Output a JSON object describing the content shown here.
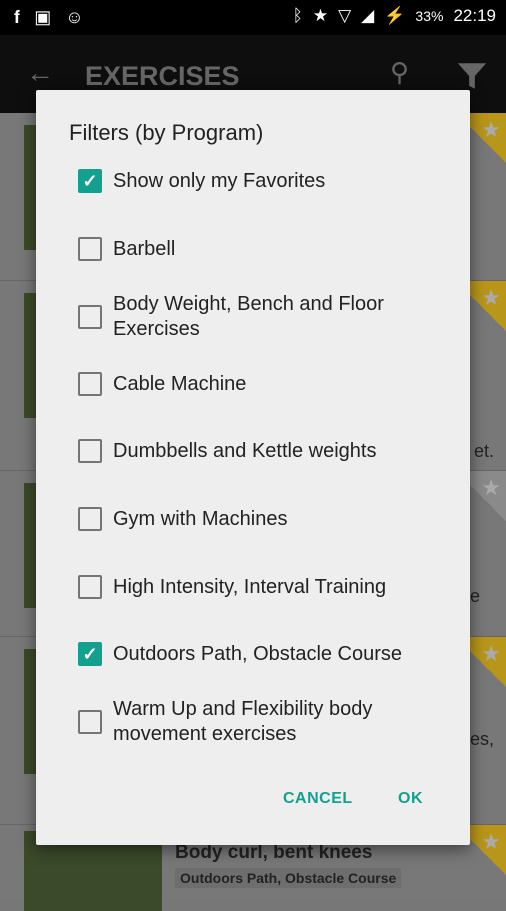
{
  "status_bar": {
    "left_icons": [
      "facebook-icon",
      "image-icon",
      "cyanogen-icon"
    ],
    "right_icons": [
      "bluetooth-icon",
      "star-icon",
      "wifi-icon",
      "lte-signal-icon",
      "battery-saver-icon"
    ],
    "battery": "33%",
    "time": "22:19"
  },
  "app_bar": {
    "title": "EXERCISES"
  },
  "background_list": {
    "fragments": [
      "et.",
      "e",
      "es,"
    ],
    "last_row": {
      "title": "Body curl, bent knees",
      "tag": "Outdoors Path, Obstacle Course"
    }
  },
  "dialog": {
    "title": "Filters (by Program)",
    "options": [
      {
        "label": "Show only my Favorites",
        "checked": true
      },
      {
        "label": "Barbell",
        "checked": false
      },
      {
        "label": "Body Weight, Bench and Floor Exercises",
        "checked": false
      },
      {
        "label": "Cable Machine",
        "checked": false
      },
      {
        "label": "Dumbbells and Kettle weights",
        "checked": false
      },
      {
        "label": "Gym with Machines",
        "checked": false
      },
      {
        "label": "High Intensity, Interval Training",
        "checked": false
      },
      {
        "label": "Outdoors Path, Obstacle Course",
        "checked": true
      },
      {
        "label": "Warm Up and  Flexibility body movement exercises",
        "checked": false
      }
    ],
    "cancel": "CANCEL",
    "ok": "OK"
  },
  "colors": {
    "accent": "#14a08e",
    "ribbon": "#f2c42a"
  }
}
